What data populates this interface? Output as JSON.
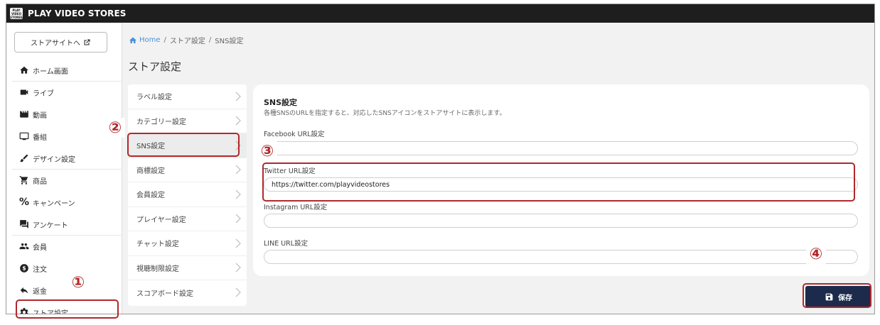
{
  "app": {
    "logo_lines": [
      "PLAY",
      "VIDEO",
      "STORES"
    ],
    "title": "PLAY VIDEO STORES"
  },
  "sidebar": {
    "store_site_label": "ストアサイトへ",
    "items": [
      {
        "label": "ホーム画面",
        "icon": "home-icon"
      },
      {
        "label": "ライブ",
        "icon": "videocam-icon"
      },
      {
        "label": "動画",
        "icon": "movie-icon"
      },
      {
        "label": "番組",
        "icon": "tv-icon"
      },
      {
        "label": "デザイン設定",
        "icon": "brush-icon"
      },
      {
        "label": "商品",
        "icon": "cart-icon"
      },
      {
        "label": "キャンペーン",
        "icon": "percent-icon"
      },
      {
        "label": "アンケート",
        "icon": "survey-icon"
      },
      {
        "label": "会員",
        "icon": "people-icon"
      },
      {
        "label": "注文",
        "icon": "dollar-icon"
      },
      {
        "label": "返金",
        "icon": "reply-icon"
      },
      {
        "label": "ストア設定",
        "icon": "gear-icon"
      }
    ]
  },
  "breadcrumb": {
    "home": "Home",
    "level1": "ストア設定",
    "level2": "SNS設定",
    "separator": "/"
  },
  "page_title": "ストア設定",
  "settings_menu": [
    "ラベル設定",
    "カテゴリー設定",
    "SNS設定",
    "商標設定",
    "会員設定",
    "プレイヤー設定",
    "チャット設定",
    "視聴制限設定",
    "スコアボード設定"
  ],
  "sns_card": {
    "title": "SNS設定",
    "description": "各種SNSのURLを指定すると、対応したSNSアイコンをストアサイトに表示します。",
    "fields": [
      {
        "label": "Facebook URL設定",
        "value": ""
      },
      {
        "label": "Twitter URL設定",
        "value": "https://twitter.com/playvideostores"
      },
      {
        "label": "Instagram URL設定",
        "value": ""
      },
      {
        "label": "LINE URL設定",
        "value": ""
      }
    ]
  },
  "save_label": "保存",
  "annotations": [
    "①",
    "②",
    "③",
    "④"
  ],
  "colors": {
    "accent_dark": "#1c2b4b",
    "annotation_red": "#b2282b",
    "link_blue": "#4a90d9",
    "topbar": "#1e1e1e"
  }
}
